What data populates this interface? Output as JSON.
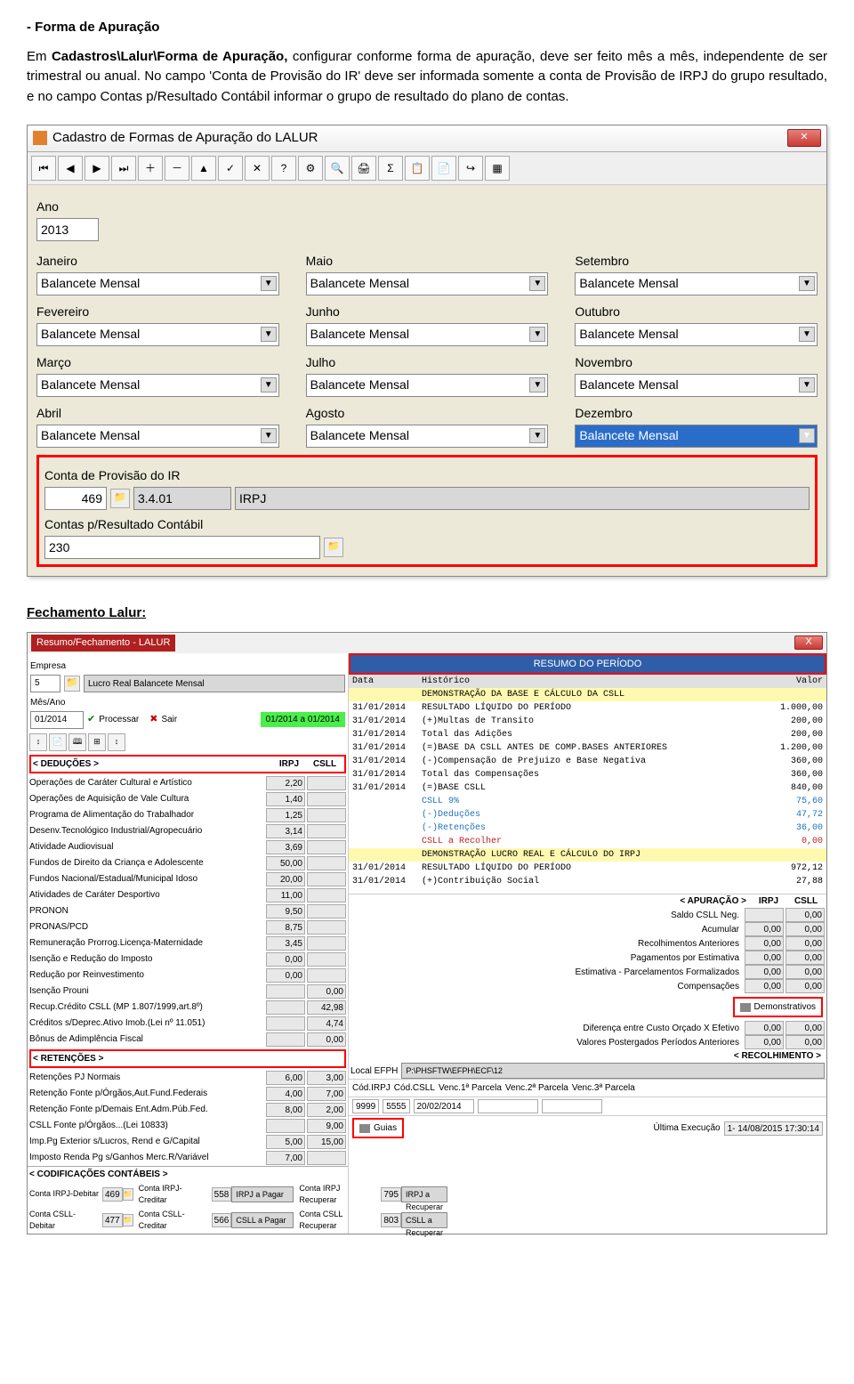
{
  "doc": {
    "heading": "- Forma de Apuração",
    "para_before": "Em ",
    "para_path": "Cadastros\\Lalur\\Forma de Apuração,",
    "para_rest": " configurar conforme forma de apuração, deve ser feito mês a mês, independente de ser trimestral ou anual. No campo 'Conta de Provisão do IR' deve ser informada somente a conta de Provisão de IRPJ do grupo resultado, e no campo Contas p/Resultado Contábil informar o grupo de resultado do plano de contas.",
    "heading2": "Fechamento Lalur:"
  },
  "win1": {
    "title": "Cadastro de Formas de Apuração do LALUR",
    "year_label": "Ano",
    "year_value": "2013",
    "months": [
      {
        "label": "Janeiro",
        "value": "Balancete Mensal"
      },
      {
        "label": "Maio",
        "value": "Balancete Mensal"
      },
      {
        "label": "Setembro",
        "value": "Balancete Mensal"
      },
      {
        "label": "Fevereiro",
        "value": "Balancete Mensal"
      },
      {
        "label": "Junho",
        "value": "Balancete Mensal"
      },
      {
        "label": "Outubro",
        "value": "Balancete Mensal"
      },
      {
        "label": "Março",
        "value": "Balancete Mensal"
      },
      {
        "label": "Julho",
        "value": "Balancete Mensal"
      },
      {
        "label": "Novembro",
        "value": "Balancete Mensal"
      },
      {
        "label": "Abril",
        "value": "Balancete Mensal"
      },
      {
        "label": "Agosto",
        "value": "Balancete Mensal"
      },
      {
        "label": "Dezembro",
        "value": "Balancete Mensal",
        "highlight": true
      }
    ],
    "conta_ir_label": "Conta de Provisão do IR",
    "conta_ir_num": "469",
    "conta_ir_cod": "3.4.01",
    "conta_ir_desc": "IRPJ",
    "contas_res_label": "Contas p/Resultado Contábil",
    "contas_res_num": "230"
  },
  "win2": {
    "menubar_title": "Resumo/Fechamento - LALUR",
    "close_x": "X",
    "empresa_label": "Empresa",
    "empresa_num": "5",
    "empresa_desc": "Lucro Real Balancete Mensal",
    "mesano_label": "Mês/Ano",
    "mesano_val": "01/2014",
    "processar": "Processar",
    "sair": "Sair",
    "periodo_chip": "01/2014 a 01/2014",
    "ded_header": "< DEDUÇÕES >",
    "col_irpj": "IRPJ",
    "col_csll": "CSLL",
    "deducoes": [
      {
        "nm": "Operações de Caráter Cultural e Artístico",
        "v1": "2,20",
        "v2": ""
      },
      {
        "nm": "Operações de Aquisição de Vale Cultura",
        "v1": "1,40",
        "v2": ""
      },
      {
        "nm": "Programa de Alimentação do Trabalhador",
        "v1": "1,25",
        "v2": ""
      },
      {
        "nm": "Desenv.Tecnológico Industrial/Agropecuário",
        "v1": "3,14",
        "v2": ""
      },
      {
        "nm": "Atividade Audiovisual",
        "v1": "3,69",
        "v2": ""
      },
      {
        "nm": "Fundos de Direito da Criança e Adolescente",
        "v1": "50,00",
        "v2": ""
      },
      {
        "nm": "Fundos Nacional/Estadual/Municipal Idoso",
        "v1": "20,00",
        "v2": ""
      },
      {
        "nm": "Atividades de Caráter Desportivo",
        "v1": "11,00",
        "v2": ""
      },
      {
        "nm": "PRONON",
        "v1": "9,50",
        "v2": ""
      },
      {
        "nm": "PRONAS/PCD",
        "v1": "8,75",
        "v2": ""
      },
      {
        "nm": "Remuneração Prorrog.Licença-Maternidade",
        "v1": "3,45",
        "v2": ""
      },
      {
        "nm": "Isenção e Redução do Imposto",
        "v1": "0,00",
        "v2": ""
      },
      {
        "nm": "Redução por Reinvestimento",
        "v1": "0,00",
        "v2": ""
      },
      {
        "nm": "Isenção Prouni",
        "v1": "",
        "v2": "0,00"
      },
      {
        "nm": "Recup.Crédito CSLL (MP 1.807/1999,art.8º)",
        "v1": "",
        "v2": "42,98"
      },
      {
        "nm": "Créditos s/Deprec.Ativo Imob.(Lei nº 11.051)",
        "v1": "",
        "v2": "4,74"
      },
      {
        "nm": "Bônus de Adimplência Fiscal",
        "v1": "",
        "v2": "0,00"
      }
    ],
    "ret_header": "< RETENÇÕES >",
    "retencoes": [
      {
        "nm": "Retenções PJ Normais",
        "v1": "6,00",
        "v2": "3,00"
      },
      {
        "nm": "Retenção Fonte p/Órgãos,Aut.Fund.Federais",
        "v1": "4,00",
        "v2": "7,00"
      },
      {
        "nm": "Retenção Fonte p/Demais Ent.Adm.Púb.Fed.",
        "v1": "8,00",
        "v2": "2,00"
      },
      {
        "nm": "CSLL Fonte p/Órgãos...(Lei 10833)",
        "v1": "",
        "v2": "9,00"
      },
      {
        "nm": "Imp.Pg Exterior s/Lucros, Rend e G/Capital",
        "v1": "5,00",
        "v2": "15,00"
      },
      {
        "nm": "Imposto Renda Pg s/Ganhos Merc.R/Variável",
        "v1": "7,00",
        "v2": ""
      }
    ],
    "cod_header": "< CODIFICAÇÕES CONTÁBEIS >",
    "cod_rows": [
      {
        "l1": "Conta IRPJ-Debitar",
        "v1": "469",
        "l2": "Conta IRPJ-Creditar",
        "v2": "558",
        "d2": "IRPJ a Pagar",
        "l3": "Conta IRPJ Recuperar",
        "v3": "795",
        "d3": "IRPJ a Recuperar"
      },
      {
        "l1": "Conta CSLL-Debitar",
        "v1": "477",
        "l2": "Conta CSLL-Creditar",
        "v2": "566",
        "d2": "CSLL a Pagar",
        "l3": "Conta CSLL Recuperar",
        "v3": "803",
        "d3": "CSLL a Recuperar"
      }
    ],
    "resumo_title": "RESUMO DO PERÍODO",
    "tbl_h_data": "Data",
    "tbl_h_hist": "Histórico",
    "tbl_h_val": "Valor",
    "rows": [
      {
        "y": true,
        "d": "",
        "h": "DEMONSTRAÇÃO DA BASE E CÁLCULO DA CSLL",
        "v": ""
      },
      {
        "d": "31/01/2014",
        "h": "RESULTADO LÍQUIDO DO PERÍODO",
        "v": "1.000,00"
      },
      {
        "d": "31/01/2014",
        "h": "(+)Multas de Transito",
        "v": "200,00"
      },
      {
        "d": "31/01/2014",
        "h": "Total das Adições",
        "v": "200,00"
      },
      {
        "d": "31/01/2014",
        "h": "(=)BASE DA CSLL ANTES DE COMP.BASES ANTERIORES",
        "v": "1.200,00"
      },
      {
        "d": "31/01/2014",
        "h": "(-)Compensação de Prejuizo e Base Negativa",
        "v": "360,00"
      },
      {
        "d": "31/01/2014",
        "h": "Total das Compensações",
        "v": "360,00"
      },
      {
        "d": "31/01/2014",
        "h": "(=)BASE CSLL",
        "v": "840,00"
      },
      {
        "blue": true,
        "d": "",
        "h": "CSLL 9%",
        "v": "75,60"
      },
      {
        "blue": true,
        "d": "",
        "h": "(-)Deduções",
        "v": "47,72"
      },
      {
        "blue": true,
        "d": "",
        "h": "(-)Retenções",
        "v": "36,00"
      },
      {
        "red": true,
        "d": "",
        "h": "CSLL a Recolher",
        "v": "0,00"
      },
      {
        "d": "",
        "h": "",
        "v": ""
      },
      {
        "y": true,
        "d": "",
        "h": "DEMONSTRAÇÃO LUCRO REAL E CÁLCULO DO IRPJ",
        "v": ""
      },
      {
        "d": "31/01/2014",
        "h": "RESULTADO LÍQUIDO DO PERÍODO",
        "v": "972,12"
      },
      {
        "d": "31/01/2014",
        "h": "(+)Contribuição Social",
        "v": "27,88"
      }
    ],
    "apur_header": "< APURAÇÃO >",
    "apur_cols": {
      "c1": "IRPJ",
      "c2": "CSLL"
    },
    "apur_rows": [
      {
        "nm": "Saldo CSLL Neg.",
        "v1": "",
        "v2": "0,00"
      },
      {
        "nm": "Acumular",
        "v1": "0,00",
        "v2": "0,00"
      },
      {
        "nm": "Recolhimentos Anteriores",
        "v1": "0,00",
        "v2": "0,00"
      },
      {
        "nm": "Pagamentos por Estimativa",
        "v1": "0,00",
        "v2": "0,00"
      },
      {
        "nm": "Estimativa - Parcelamentos Formalizados",
        "v1": "0,00",
        "v2": "0,00"
      },
      {
        "nm": "Compensações",
        "v1": "0,00",
        "v2": "0,00"
      }
    ],
    "btn_demonstrativos": "Demonstrativos",
    "diff_rows": [
      {
        "nm": "Diferença entre Custo Orçado X Efetivo",
        "v1": "0,00",
        "v2": "0,00"
      },
      {
        "nm": "Valores Postergados Períodos Anteriores",
        "v1": "0,00",
        "v2": "0,00"
      }
    ],
    "recol_header": "< RECOLHIMENTO >",
    "local_efph_label": "Local EFPH",
    "local_efph_val": "P:\\PHSFTW\\EFPH\\ECF\\12",
    "foot_labels": {
      "cirpj": "Cód.IRPJ",
      "ccsll": "Cód.CSLL",
      "v1p": "Venc.1ª Parcela",
      "v2p": "Venc.2ª Parcela",
      "v3p": "Venc.3ª Parcela"
    },
    "foot_vals": {
      "cirpj": "9999",
      "ccsll": "5555",
      "v1p": "20/02/2014",
      "v2p": "",
      "v3p": ""
    },
    "btn_guias": "Guias",
    "ultima_exec_label": "Última Execução",
    "ultima_exec_val": "1- 14/08/2015 17:30:14"
  }
}
